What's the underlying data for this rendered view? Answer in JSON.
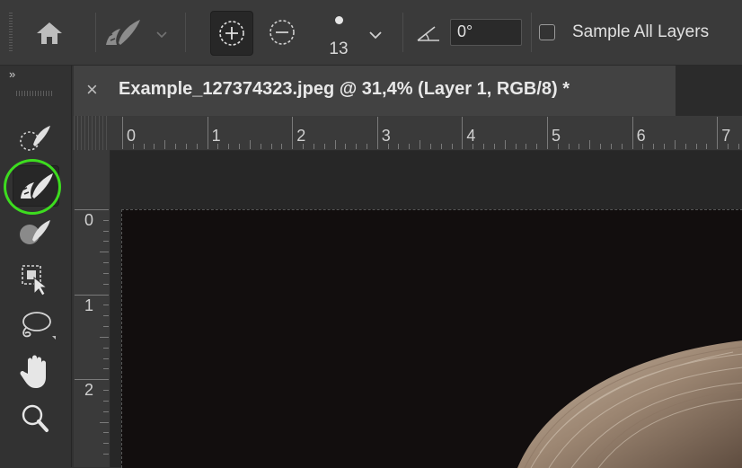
{
  "options_bar": {
    "brush_size": "13",
    "angle_value": "0°",
    "sample_all_layers_label": "Sample All Layers",
    "sample_all_layers_checked": false
  },
  "toolbar": {
    "collapse_label": "»",
    "tools": [
      {
        "name": "quick-selection-tool",
        "icon": "quick-selection-icon"
      },
      {
        "name": "spot-healing-brush-tool",
        "icon": "spot-healing-brush-icon",
        "active": true
      },
      {
        "name": "healing-brush-tool",
        "icon": "healing-brush-icon"
      },
      {
        "name": "object-selection-tool",
        "icon": "object-selection-icon"
      },
      {
        "name": "lasso-tool",
        "icon": "lasso-icon"
      },
      {
        "name": "hand-tool",
        "icon": "hand-icon"
      },
      {
        "name": "zoom-tool",
        "icon": "zoom-icon"
      }
    ],
    "highlight_color": "#3ddc1f"
  },
  "document_tab": {
    "close_label": "×",
    "title": "Example_127374323.jpeg @ 31,4% (Layer 1, RGB/8) *"
  },
  "rulers": {
    "top_labels": [
      "0",
      "1",
      "2",
      "3",
      "4",
      "5",
      "6",
      "7"
    ],
    "left_labels": [
      "0",
      "1",
      "2"
    ]
  },
  "colors": {
    "panel": "#323232",
    "options_bar": "#3a3a3a",
    "canvas_background": "#120e0e"
  }
}
